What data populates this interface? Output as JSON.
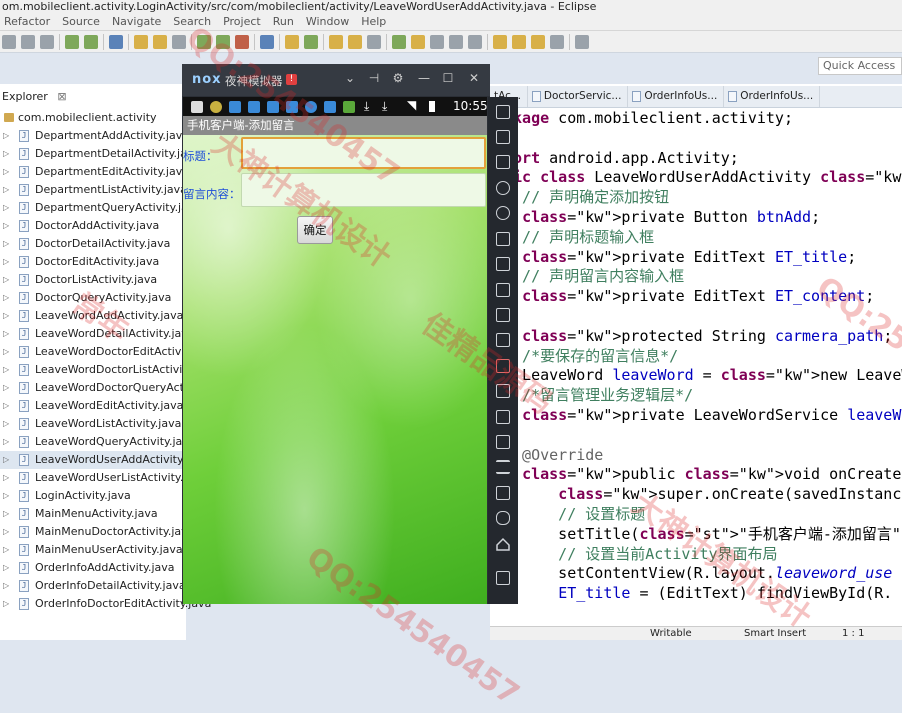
{
  "window": {
    "title": "om.mobileclient.activity.LoginActivity/src/com/mobileclient/activity/LeaveWordUserAddActivity.java - Eclipse"
  },
  "menu": [
    "Refactor",
    "Source",
    "Navigate",
    "Search",
    "Project",
    "Run",
    "Window",
    "Help"
  ],
  "toolbar": {
    "quick_access_placeholder": "Quick Access"
  },
  "explorer": {
    "tab_label": "Explorer",
    "package": "com.mobileclient.activity",
    "files": [
      "DepartmentAddActivity.java",
      "DepartmentDetailActivity.java",
      "DepartmentEditActivity.java",
      "DepartmentListActivity.java",
      "DepartmentQueryActivity.java",
      "DoctorAddActivity.java",
      "DoctorDetailActivity.java",
      "DoctorEditActivity.java",
      "DoctorListActivity.java",
      "DoctorQueryActivity.java",
      "LeaveWordAddActivity.java",
      "LeaveWordDetailActivity.java",
      "LeaveWordDoctorEditActivit",
      "LeaveWordDoctorListActivity",
      "LeaveWordDoctorQueryActi",
      "LeaveWordEditActivity.java",
      "LeaveWordListActivity.java",
      "LeaveWordQueryActivity.java",
      "LeaveWordUserAddActivity.j",
      "LeaveWordUserListActivity.j",
      "LoginActivity.java",
      "MainMenuActivity.java",
      "MainMenuDoctorActivity.java",
      "MainMenuUserActivity.java",
      "OrderInfoAddActivity.java",
      "OrderInfoDetailActivity.java",
      "OrderInfoDoctorEditActivity.java"
    ],
    "selected_index": 18
  },
  "editor": {
    "tabs": [
      "tAc...",
      "DoctorServic...",
      "OrderInfoUs...",
      "OrderInfoUs..."
    ],
    "lines": [
      "ckage com.mobileclient.activity;",
      "",
      "port android.app.Activity;",
      "lic class LeaveWordUserAddActivity extends",
      "  // 声明确定添加按钮",
      "  private Button btnAdd;",
      "  // 声明标题输入框",
      "  private EditText ET_title;",
      "  // 声明留言内容输入框",
      "  private EditText ET_content;",
      "",
      "  protected String carmera_path;",
      "  /*要保存的留言信息*/",
      "  LeaveWord leaveWord = new LeaveWord();",
      "  /*留言管理业务逻辑层*/",
      "  private LeaveWordService leaveWordService",
      "",
      "  @Override",
      "  public void onCreate(Bundle savedInstance",
      "      super.onCreate(savedInstanceState);",
      "      // 设置标题",
      "      setTitle(\"手机客户端-添加留言\");",
      "      // 设置当前Activity界面布局",
      "      setContentView(R.layout.leaveword_use",
      "      ET_title = (EditText) findViewById(R."
    ]
  },
  "status": {
    "writable": "Writable",
    "insert_mode": "Smart Insert",
    "position": "1 : 1"
  },
  "emulator": {
    "logo": "nox",
    "name": "夜神模拟器",
    "badge": "!",
    "time": "10:55",
    "app_title": "手机客户端-添加留言",
    "title_label": "标题：",
    "content_label": "留言内容：",
    "confirm_button": "确定"
  },
  "watermarks": [
    "QQ:254540457",
    "大神计算机设计",
    "常年",
    "佳精品源码",
    "QQ:2545",
    "大神计算机设计",
    "QQ:254540457"
  ]
}
